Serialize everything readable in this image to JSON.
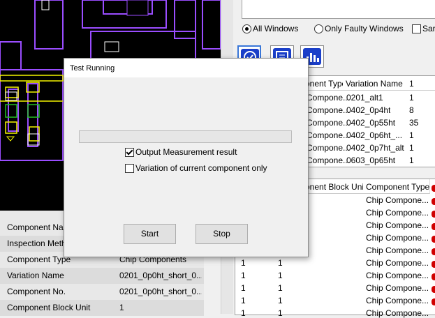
{
  "dialog": {
    "title": "Test Running",
    "progress": 0,
    "output_measurement_label": "Output Measurement result",
    "output_measurement_checked": true,
    "variation_only_label": "Variation of current component only",
    "variation_only_checked": false,
    "start_label": "Start",
    "stop_label": "Stop"
  },
  "filters": {
    "all_windows_label": "All Windows",
    "all_windows_selected": true,
    "only_faulty_label": "Only Faulty Windows",
    "only_faulty_selected": false,
    "same_label": "Sar"
  },
  "toolbar": {
    "icons": [
      "run-test-icon",
      "measure-icon",
      "chart-icon"
    ]
  },
  "variation_table": {
    "headers": [
      "onent Type",
      "Variation Name",
      "1"
    ],
    "rows": [
      [
        "Compone...",
        "0201_alt1",
        "1"
      ],
      [
        "Compone...",
        "0402_0p4ht",
        "8"
      ],
      [
        "Compone...",
        "0402_0p55ht",
        "35"
      ],
      [
        "Compone...",
        "0402_0p6ht_...",
        "1"
      ],
      [
        "Compone...",
        "0402_0p7ht_alt",
        "1"
      ],
      [
        "Compone...",
        "0603_0p65ht",
        "1"
      ]
    ]
  },
  "block_table": {
    "headers": [
      "onent Block Unit",
      "Component Type"
    ],
    "rows": [
      [
        "",
        "",
        "Chip Compone..."
      ],
      [
        "",
        "",
        "Chip Compone..."
      ],
      [
        "",
        "",
        "Chip Compone..."
      ],
      [
        "",
        "",
        "Chip Compone..."
      ],
      [
        "",
        "",
        "Chip Compone..."
      ],
      [
        "1",
        "1",
        "Chip Compone..."
      ],
      [
        "1",
        "1",
        "Chip Compone..."
      ],
      [
        "1",
        "1",
        "Chip Compone..."
      ],
      [
        "1",
        "1",
        "Chip Compone..."
      ],
      [
        "1",
        "1",
        "Chip Compone..."
      ]
    ]
  },
  "properties": [
    {
      "label": "Component Nar",
      "value": ""
    },
    {
      "label": "Inspection Meth",
      "value": ""
    },
    {
      "label": "Component Type",
      "value": "Chip Components"
    },
    {
      "label": "Variation Name",
      "value": "0201_0p0ht_short_0..."
    },
    {
      "label": "Component No.",
      "value": "0201_0p0ht_short_0..."
    },
    {
      "label": "Component Block Unit",
      "value": "1"
    }
  ],
  "colors": {
    "accent": "#1b3fc9",
    "fault": "#d00000",
    "cad_outline": "#9a4dff",
    "cad_pad": "#f5f500"
  }
}
